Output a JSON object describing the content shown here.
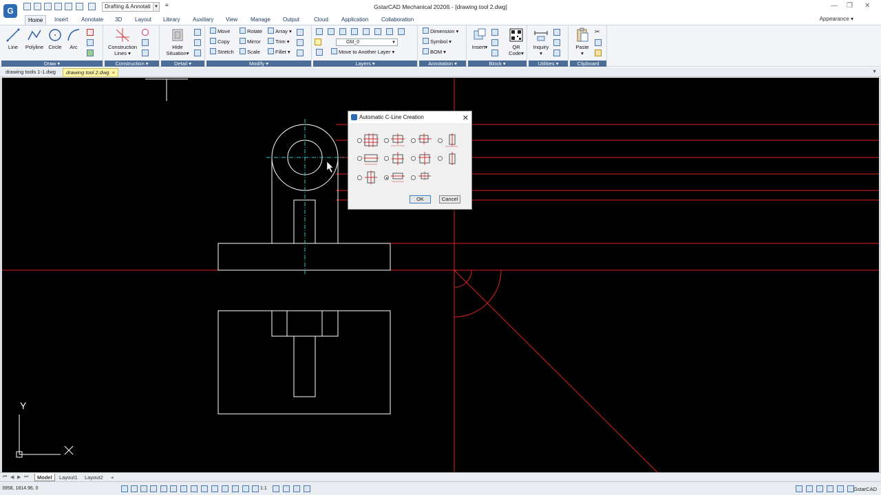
{
  "app": {
    "logo_letter": "G",
    "workspace": "Drafting & Annotati",
    "window_title": "GstarCAD Mechanical 2020ß - [drawing tool 2.dwg]",
    "appearance_label": "Appearance"
  },
  "ribbon_tabs": [
    "Home",
    "Insert",
    "Annotate",
    "3D",
    "Layout",
    "Library",
    "Auxiliary",
    "View",
    "Manage",
    "Output",
    "Cloud",
    "Application",
    "Collaboration"
  ],
  "panels": {
    "draw": {
      "title": "Draw",
      "line": "Line",
      "polyline": "Polyline",
      "circle": "Circle",
      "arc": "Arc"
    },
    "construction": {
      "title": "Construction",
      "lines_label_1": "Construction",
      "lines_label_2": "Lines"
    },
    "detail": {
      "title": "Detail",
      "hide_1": "Hide",
      "hide_2": "Situation"
    },
    "modify": {
      "title": "Modify",
      "move": "Move",
      "rotate": "Rotate",
      "array": "Array",
      "copy": "Copy",
      "mirror": "Mirror",
      "trim": "Trim",
      "stretch": "Stretch",
      "scale": "Scale",
      "fillet": "Fillet"
    },
    "layers": {
      "title": "Layers",
      "current_layer": "GM_0",
      "move_to_layer": "Move to Another Layer"
    },
    "annotation": {
      "title": "Annotation",
      "dimension": "Dimension",
      "symbol": "Symbol",
      "bom": "BOM"
    },
    "block": {
      "title": "Block",
      "insert": "Insert",
      "qr_1": "QR",
      "qr_2": "Code"
    },
    "utilities": {
      "title": "Utilities",
      "inquiry": "Inquiry"
    },
    "clipboard": {
      "title": "Clipboard",
      "paste": "Paste"
    }
  },
  "doc_tabs": [
    {
      "label": "drawing tools 1-1.dwg",
      "active": false
    },
    {
      "label": "drawing tool 2.dwg",
      "active": true
    }
  ],
  "doc_tab_close": "×",
  "ucs": {
    "x_label": "X",
    "y_label": "Y"
  },
  "dialog": {
    "title": "Automatic C-Line Creation",
    "close": "✕",
    "ok": "OK",
    "cancel": "Cancel",
    "selected_option": 9
  },
  "layout_tabs": [
    {
      "label": "Model",
      "active": true
    },
    {
      "label": "Layout1",
      "active": false
    },
    {
      "label": "Layout2",
      "active": false
    }
  ],
  "layout_add": "+",
  "status": {
    "coords": "3958, 1814.96, 0",
    "scale": "1:1",
    "app_name": "GstarCAD"
  },
  "colors": {
    "canvas": "#000000",
    "red_line": "#e32020",
    "cyan_center": "#2fc7c7",
    "white_line": "#ffffff",
    "panel_title": "#4a6c96"
  }
}
